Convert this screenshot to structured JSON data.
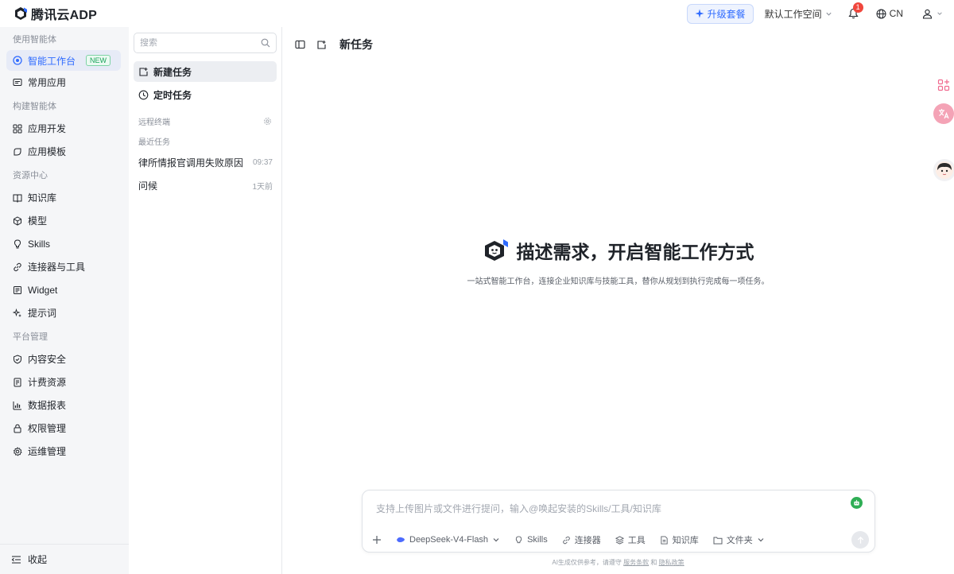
{
  "brand": {
    "name": "腾讯云ADP"
  },
  "topbar": {
    "upgrade_label": "升级套餐",
    "workspace_label": "默认工作空间",
    "notification_count": "1",
    "language": "CN"
  },
  "nav": {
    "sections": [
      {
        "title": "使用智能体"
      },
      {
        "title": "构建智能体"
      },
      {
        "title": "资源中心"
      },
      {
        "title": "平台管理"
      }
    ],
    "items": [
      {
        "label": "智能工作台",
        "badge": "NEW",
        "icon": "smart-workbench-icon"
      },
      {
        "label": "常用应用",
        "icon": "message-icon"
      },
      {
        "label": "应用开发",
        "icon": "grid-icon"
      },
      {
        "label": "应用模板",
        "icon": "template-icon"
      },
      {
        "label": "知识库",
        "icon": "book-icon"
      },
      {
        "label": "模型",
        "icon": "cube-icon"
      },
      {
        "label": "Skills",
        "icon": "bulb-icon"
      },
      {
        "label": "连接器与工具",
        "icon": "link-icon"
      },
      {
        "label": "Widget",
        "icon": "widget-icon"
      },
      {
        "label": "提示词",
        "icon": "sparkle-icon"
      },
      {
        "label": "内容安全",
        "icon": "shield-icon"
      },
      {
        "label": "计费资源",
        "icon": "billing-icon"
      },
      {
        "label": "数据报表",
        "icon": "bar-chart-icon"
      },
      {
        "label": "权限管理",
        "icon": "lock-icon"
      },
      {
        "label": "运维管理",
        "icon": "gear-icon"
      }
    ],
    "collapse_label": "收起"
  },
  "tasks": {
    "search_placeholder": "搜索",
    "new_task": "新建任务",
    "scheduled_task": "定时任务",
    "remote_terminal": "远程终端",
    "recent_title": "最近任务",
    "recent": [
      {
        "title": "律所情报官调用失败原因",
        "time": "09:37"
      },
      {
        "title": "问候",
        "time": "1天前"
      }
    ]
  },
  "main": {
    "title": "新任务",
    "hero_title": "描述需求，开启智能工作方式",
    "hero_subtitle": "一站式智能工作台，连接企业知识库与技能工具，替你从规划到执行完成每一项任务。",
    "composer": {
      "placeholder": "支持上传图片或文件进行提问，输入@唤起安装的Skills/工具/知识库",
      "model": "DeepSeek-V4-Flash",
      "tools": [
        "Skills",
        "连接器",
        "工具",
        "知识库",
        "文件夹"
      ]
    },
    "footnote_prefix": "AI生成仅供参考，请遵守",
    "footnote_terms": "服务条款",
    "footnote_and": "和",
    "footnote_privacy": "隐私政策"
  },
  "colors": {
    "accent": "#2f6bff",
    "nav_bg": "#f5f6f8",
    "badge_red": "#f0473d",
    "new_green": "#1aa35a"
  }
}
